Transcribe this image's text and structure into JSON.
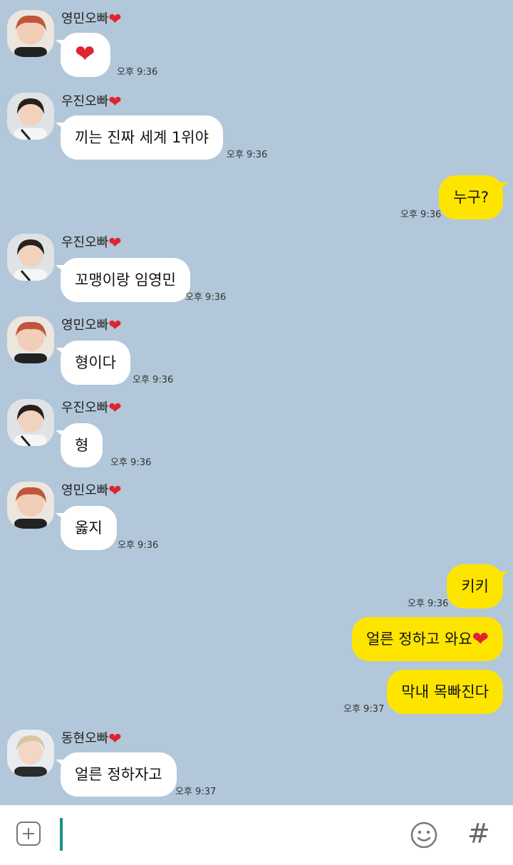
{
  "colors": {
    "background": "#b2c7d9",
    "incoming": "#ffffff",
    "outgoing": "#fee500",
    "heart": "#e0242f"
  },
  "messages": [
    {
      "sender": "영민오빠",
      "heart": "❤",
      "text": "❤",
      "time": "오후 9:36",
      "avatar": "red-hair"
    },
    {
      "sender": "우진오빠",
      "heart": "❤",
      "text": "끼는 진짜 세계 1위야",
      "time": "오후 9:36",
      "avatar": "dark-hair"
    },
    {
      "text": "누구?",
      "time": "오후 9:36"
    },
    {
      "sender": "우진오빠",
      "heart": "❤",
      "text": "꼬맹이랑 임영민",
      "time": "오후 9:36",
      "avatar": "dark-hair"
    },
    {
      "sender": "영민오빠",
      "heart": "❤",
      "text": "형이다",
      "time": "오후 9:36",
      "avatar": "red-hair"
    },
    {
      "sender": "우진오빠",
      "heart": "❤",
      "text": "형",
      "time": "오후 9:36",
      "avatar": "dark-hair"
    },
    {
      "sender": "영민오빠",
      "heart": "❤",
      "text": "옳지",
      "time": "오후 9:36",
      "avatar": "red-hair"
    },
    {
      "text": "키키",
      "time": "오후 9:36"
    },
    {
      "text": "얼른 정하고 와요",
      "heart": "❤"
    },
    {
      "text": "막내 목빠진다",
      "time": "오후 9:37"
    },
    {
      "sender": "동현오빠",
      "heart": "❤",
      "text": "얼른 정하자고",
      "time": "오후 9:37",
      "avatar": "blond-hair"
    }
  ],
  "input": {
    "placeholder": "",
    "plus_icon": "plus-square-icon",
    "emoji_icon": "smile-icon",
    "hash_label": "#"
  }
}
